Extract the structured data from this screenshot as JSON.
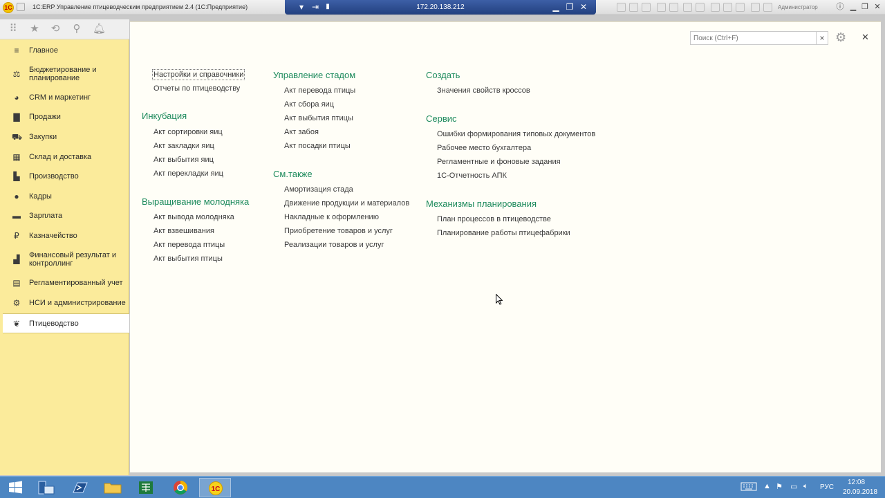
{
  "titlebar": {
    "window_title": "1С:ERP Управление птицеводческим предприятием 2.4  (1С:Предприятие)",
    "remote_ip": "172.20.138.212",
    "user": "Администратор"
  },
  "sidebar": {
    "items": [
      {
        "label": "Главное",
        "icon": "menu-lines-icon"
      },
      {
        "label": "Бюджетирование и планирование",
        "icon": "budget-icon"
      },
      {
        "label": "CRM и маркетинг",
        "icon": "pie-chart-icon"
      },
      {
        "label": "Продажи",
        "icon": "bag-icon"
      },
      {
        "label": "Закупки",
        "icon": "cart-icon"
      },
      {
        "label": "Склад и доставка",
        "icon": "warehouse-icon"
      },
      {
        "label": "Производство",
        "icon": "factory-icon"
      },
      {
        "label": "Кадры",
        "icon": "person-icon"
      },
      {
        "label": "Зарплата",
        "icon": "wallet-icon"
      },
      {
        "label": "Казначейство",
        "icon": "coin-icon"
      },
      {
        "label": "Финансовый результат и контроллинг",
        "icon": "bar-chart-icon"
      },
      {
        "label": "Регламентированный учет",
        "icon": "ledger-icon"
      },
      {
        "label": "НСИ и администрирование",
        "icon": "gear-icon"
      },
      {
        "label": "Птицеводство",
        "icon": "bird-icon"
      }
    ]
  },
  "content": {
    "search_placeholder": "Поиск (Ctrl+F)",
    "col1": {
      "top_cmds": [
        "Настройки и справочники",
        "Отчеты по птицеводству"
      ],
      "incubation": {
        "title": "Инкубация",
        "cmds": [
          "Акт сортировки яиц",
          "Акт закладки яиц",
          "Акт выбытия яиц",
          "Акт перекладки яиц"
        ]
      },
      "young": {
        "title": "Выращивание молодняка",
        "cmds": [
          "Акт вывода молодняка",
          "Акт взвешивания",
          "Акт перевода птицы",
          "Акт выбытия птицы"
        ]
      }
    },
    "col2": {
      "herd": {
        "title": "Управление стадом",
        "cmds": [
          "Акт перевода птицы",
          "Акт сбора яиц",
          "Акт выбытия птицы",
          "Акт забоя",
          "Акт посадки птицы"
        ]
      },
      "see_also": {
        "title": "См.также",
        "cmds": [
          "Амортизация стада",
          "Движение продукции и материалов",
          "Накладные к оформлению",
          "Приобретение товаров и услуг",
          "Реализации товаров и услуг"
        ]
      }
    },
    "col3": {
      "create": {
        "title": "Создать",
        "cmds": [
          "Значения свойств кроссов"
        ]
      },
      "service": {
        "title": "Сервис",
        "cmds": [
          "Ошибки формирования типовых документов",
          "Рабочее место бухгалтера",
          "Регламентные и фоновые задания",
          "1С-Отчетность АПК"
        ]
      },
      "planning": {
        "title": "Механизмы планирования",
        "cmds": [
          "План процессов в птицеводстве",
          "Планирование работы птицефабрики"
        ]
      }
    }
  },
  "taskbar": {
    "lang": "РУС",
    "time": "12:08",
    "date": "20.09.2018"
  },
  "colors": {
    "section_heading": "#1c8a5c",
    "sidebar_bg": "#fbeb9b",
    "content_bg": "#fffef7",
    "taskbar_bg": "#4d86c2"
  }
}
